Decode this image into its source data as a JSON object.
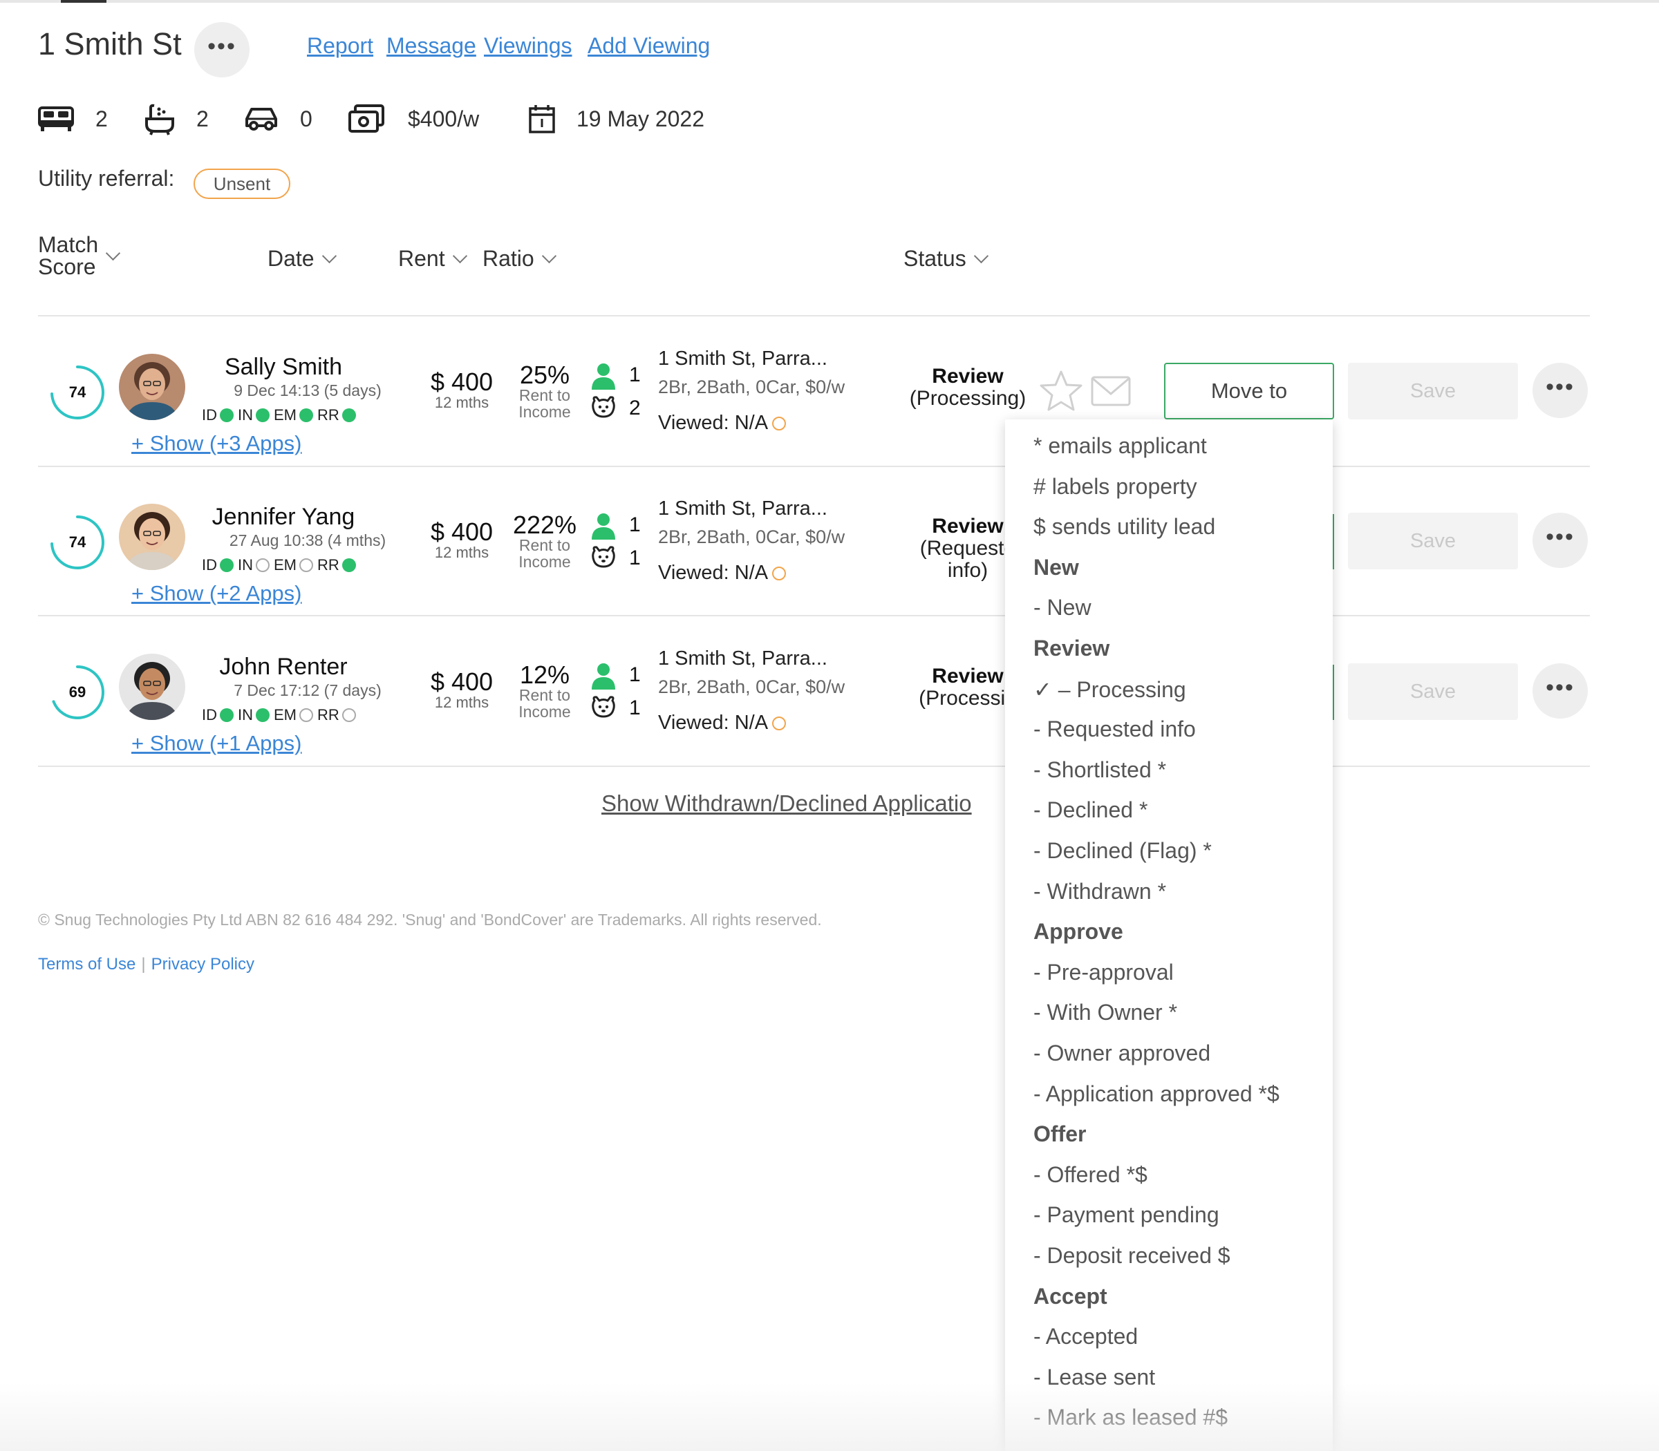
{
  "property": {
    "title": "1 Smith St",
    "links": [
      "Report",
      "Message",
      "Viewings",
      "Add Viewing"
    ],
    "features": {
      "bedrooms": "2",
      "bathrooms": "2",
      "car_spaces": "0",
      "rent": "$400/w",
      "available_date": "19 May 2022"
    },
    "utility_label": "Utility referral:",
    "utility_status": "Unsent"
  },
  "columns": {
    "match_score_line1": "Match",
    "match_score_line2": "Score",
    "date": "Date",
    "rent": "Rent",
    "ratio": "Ratio",
    "status": "Status"
  },
  "applications": [
    {
      "score": "74",
      "score_fraction": 0.74,
      "name": "Sally Smith",
      "date": "9 Dec 14:13 (5 days)",
      "checks": [
        {
          "label": "ID",
          "on": true
        },
        {
          "label": "IN",
          "on": true
        },
        {
          "label": "EM",
          "on": true
        },
        {
          "label": "RR",
          "on": true
        }
      ],
      "show_apps": "+ Show (+3 Apps)",
      "rent": "$ 400",
      "term": "12 mths",
      "ratio": "25%",
      "ratio_label_1": "Rent to",
      "ratio_label_2": "Income",
      "adults": "1",
      "pets": "2",
      "property_line": "1 Smith St, Parra...",
      "property_sub": "2Br, 2Bath, 0Car, $0/w",
      "viewed": "Viewed: N/A",
      "status_main": "Review",
      "status_sub": "(Processing)",
      "move_to": "Move to",
      "save": "Save"
    },
    {
      "score": "74",
      "score_fraction": 0.74,
      "name": "Jennifer Yang",
      "date": "27 Aug 10:38 (4 mths)",
      "checks": [
        {
          "label": "ID",
          "on": true
        },
        {
          "label": "IN",
          "on": false
        },
        {
          "label": "EM",
          "on": false
        },
        {
          "label": "RR",
          "on": true
        }
      ],
      "show_apps": "+ Show (+2 Apps)",
      "rent": "$ 400",
      "term": "12 mths",
      "ratio": "222%",
      "ratio_label_1": "Rent to",
      "ratio_label_2": "Income",
      "adults": "1",
      "pets": "1",
      "property_line": "1 Smith St, Parra...",
      "property_sub": "2Br, 2Bath, 0Car, $0/w",
      "viewed": "Viewed: N/A",
      "status_main": "Review",
      "status_sub": "(Requeste",
      "status_sub2": "info)",
      "save": "Save"
    },
    {
      "score": "69",
      "score_fraction": 0.69,
      "name": "John Renter",
      "date": "7 Dec 17:12 (7 days)",
      "checks": [
        {
          "label": "ID",
          "on": true
        },
        {
          "label": "IN",
          "on": true
        },
        {
          "label": "EM",
          "on": false
        },
        {
          "label": "RR",
          "on": false
        }
      ],
      "show_apps": "+ Show (+1 Apps)",
      "rent": "$ 400",
      "term": "12 mths",
      "ratio": "12%",
      "ratio_label_1": "Rent to",
      "ratio_label_2": "Income",
      "adults": "1",
      "pets": "1",
      "property_line": "1 Smith St, Parra...",
      "property_sub": "2Br, 2Bath, 0Car, $0/w",
      "viewed": "Viewed: N/A",
      "status_main": "Review",
      "status_sub": "(Processin",
      "save": "Save"
    }
  ],
  "show_withdrawn": "Show Withdrawn/Declined Applicatio",
  "footer": {
    "copyright": "© Snug Technologies Pty Ltd ABN 82 616 484 292. 'Snug' and 'BondCover' are Trademarks. All rights reserved.",
    "terms": "Terms of Use",
    "separator": "|",
    "privacy": "Privacy Policy"
  },
  "dropdown": {
    "items": [
      {
        "text": "* emails applicant",
        "kind": "legend"
      },
      {
        "text": "# labels property",
        "kind": "legend"
      },
      {
        "text": "$ sends utility lead",
        "kind": "legend"
      },
      {
        "text": "New",
        "kind": "group"
      },
      {
        "text": "- New",
        "kind": "option"
      },
      {
        "text": "Review",
        "kind": "group"
      },
      {
        "text": "✓ – Processing",
        "kind": "option",
        "checked": true
      },
      {
        "text": "- Requested info",
        "kind": "option"
      },
      {
        "text": "- Shortlisted *",
        "kind": "option"
      },
      {
        "text": "- Declined *",
        "kind": "option"
      },
      {
        "text": "- Declined (Flag) *",
        "kind": "option"
      },
      {
        "text": "- Withdrawn *",
        "kind": "option"
      },
      {
        "text": "Approve",
        "kind": "group"
      },
      {
        "text": "- Pre-approval",
        "kind": "option"
      },
      {
        "text": "- With Owner *",
        "kind": "option"
      },
      {
        "text": "- Owner approved",
        "kind": "option"
      },
      {
        "text": "- Application approved *$",
        "kind": "option"
      },
      {
        "text": "Offer",
        "kind": "group"
      },
      {
        "text": "- Offered *$",
        "kind": "option"
      },
      {
        "text": "- Payment pending",
        "kind": "option"
      },
      {
        "text": "- Deposit received $",
        "kind": "option"
      },
      {
        "text": "Accept",
        "kind": "group"
      },
      {
        "text": "- Accepted",
        "kind": "option"
      },
      {
        "text": "- Lease sent",
        "kind": "option"
      },
      {
        "text": "- Mark as leased #$",
        "kind": "option"
      }
    ]
  },
  "colors": {
    "link": "#3b86d6",
    "accent_green": "#2bbf6b",
    "score_ring": "#2ec4c4",
    "utility_badge": "#f2a44b"
  },
  "icons": [
    "bed-icon",
    "bath-icon",
    "car-icon",
    "rent-icon",
    "calendar-icon",
    "star-icon",
    "mail-icon",
    "person-icon",
    "pet-icon",
    "more-icon"
  ]
}
